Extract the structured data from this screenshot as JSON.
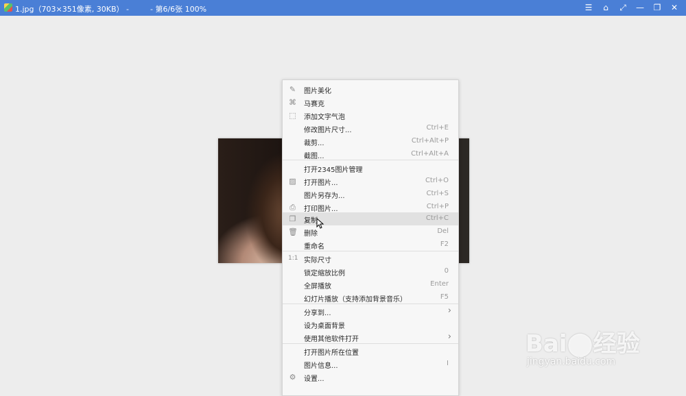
{
  "window": {
    "filename": "1.jpg",
    "info": "（703×351像素, 30KB）",
    "dash": "-",
    "page_info": "- 第6/6张 100%",
    "controls": [
      "☰",
      "⌂",
      "⤢",
      "—",
      "❐",
      "✕"
    ]
  },
  "menu": {
    "items": [
      {
        "label": "图片美化",
        "shortcut": "",
        "icon": "edit-icon"
      },
      {
        "label": "马赛克",
        "shortcut": "",
        "icon": "mosaic-icon"
      },
      {
        "label": "添加文字气泡",
        "shortcut": "",
        "icon": "text-bubble-icon"
      },
      {
        "label": "修改图片尺寸...",
        "shortcut": "Ctrl+E",
        "icon": ""
      },
      {
        "label": "裁剪...",
        "shortcut": "Ctrl+Alt+P",
        "icon": ""
      },
      {
        "label": "截图...",
        "shortcut": "Ctrl+Alt+A",
        "icon": ""
      },
      {
        "label": "打开2345图片管理",
        "shortcut": "",
        "icon": ""
      },
      {
        "label": "打开图片...",
        "shortcut": "Ctrl+O",
        "icon": "image-icon"
      },
      {
        "label": "图片另存为...",
        "shortcut": "Ctrl+S",
        "icon": ""
      },
      {
        "label": "打印图片...",
        "shortcut": "Ctrl+P",
        "icon": "printer-icon"
      },
      {
        "label": "复制",
        "shortcut": "Ctrl+C",
        "icon": "copy-icon"
      },
      {
        "label": "删除",
        "shortcut": "Del",
        "icon": "trash-icon"
      },
      {
        "label": "重命名",
        "shortcut": "F2",
        "icon": ""
      },
      {
        "label": "实际尺寸",
        "shortcut": "",
        "icon": "actual-size-icon"
      },
      {
        "label": "锁定缩放比例",
        "shortcut": "0",
        "icon": ""
      },
      {
        "label": "全屏播放",
        "shortcut": "Enter",
        "icon": ""
      },
      {
        "label": "幻灯片播放（支持添加背景音乐）",
        "shortcut": "F5",
        "icon": ""
      },
      {
        "label": "分享到...",
        "shortcut": "",
        "icon": "",
        "submenu": true
      },
      {
        "label": "设为桌面背景",
        "shortcut": "",
        "icon": ""
      },
      {
        "label": "使用其他软件打开",
        "shortcut": "",
        "icon": "",
        "submenu": true
      },
      {
        "label": "打开图片所在位置",
        "shortcut": "",
        "icon": ""
      },
      {
        "label": "图片信息...",
        "shortcut": "I",
        "icon": ""
      },
      {
        "label": "设置...",
        "shortcut": "",
        "icon": "gear-icon"
      }
    ],
    "highlighted_index": 10
  },
  "watermark": {
    "logo": "Bai⬤经验",
    "url": "jingyan.baidu.com"
  }
}
